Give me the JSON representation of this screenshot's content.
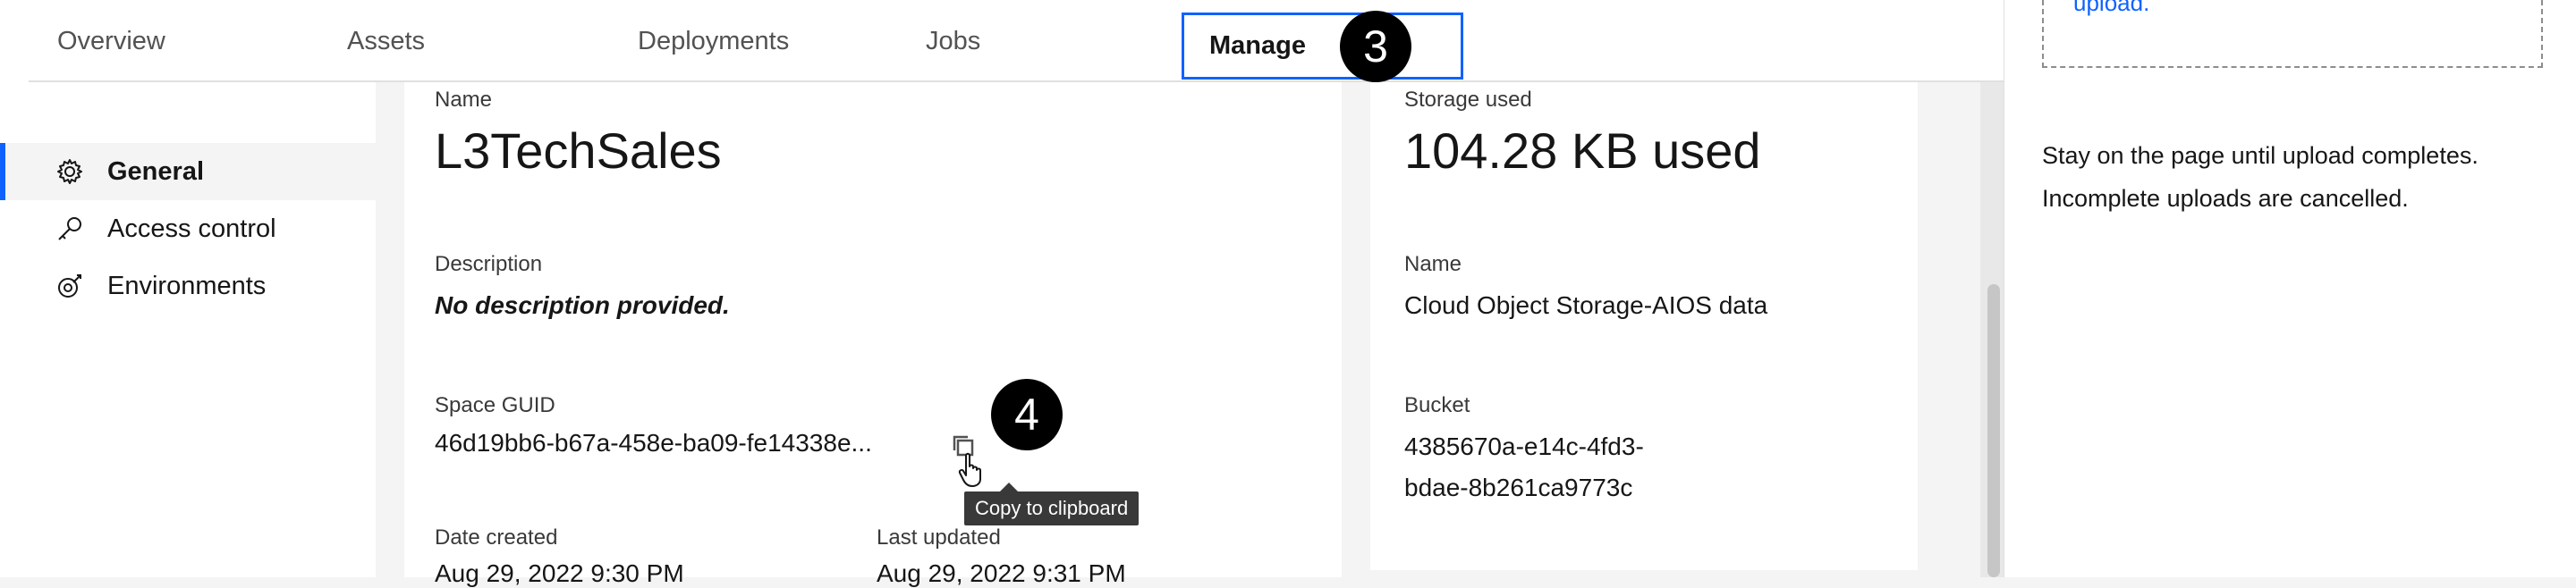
{
  "tabs": [
    {
      "label": "Overview"
    },
    {
      "label": "Assets"
    },
    {
      "label": "Deployments"
    },
    {
      "label": "Jobs"
    },
    {
      "label": "Manage"
    }
  ],
  "step_badges": {
    "manage": "3",
    "copy": "4"
  },
  "sidebar": {
    "items": [
      {
        "label": "General",
        "icon": "gear-icon",
        "selected": true
      },
      {
        "label": "Access control",
        "icon": "key-icon",
        "selected": false
      },
      {
        "label": "Environments",
        "icon": "environment-icon",
        "selected": false
      }
    ]
  },
  "details": {
    "name_label": "Name",
    "name_value": "L3TechSales",
    "description_label": "Description",
    "description_value": "No description provided.",
    "guid_label": "Space GUID",
    "guid_value": "46d19bb6-b67a-458e-ba09-fe14338e...",
    "date_created_label": "Date created",
    "date_created_value": "Aug 29, 2022 9:30 PM",
    "last_updated_label": "Last updated",
    "last_updated_value": "Aug 29, 2022 9:31 PM"
  },
  "tooltip": {
    "text": "Copy to clipboard"
  },
  "storage": {
    "used_label": "Storage used",
    "used_value": "104.28 KB used",
    "name_label": "Name",
    "name_value": "Cloud Object Storage-AIOS data",
    "bucket_label": "Bucket",
    "bucket_line1": "4385670a-e14c-4fd3-",
    "bucket_line2": "bdae-8b261ca9773c"
  },
  "drawer": {
    "upload_link": "upload.",
    "notice_line1": "Stay on the page until upload completes.",
    "notice_line2": "Incomplete uploads are cancelled."
  },
  "colors": {
    "accent": "#0f62fe",
    "badge": "#000000",
    "tooltip_bg": "#393939"
  }
}
